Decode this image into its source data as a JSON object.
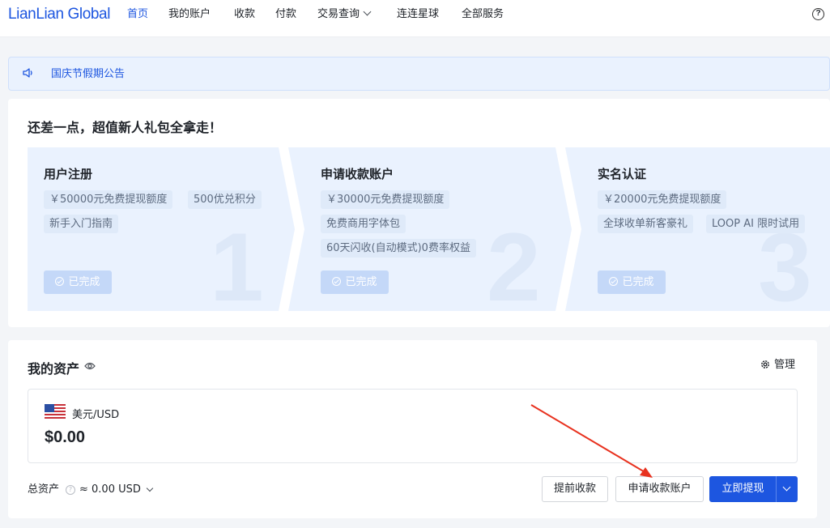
{
  "brand": "LianLian Global",
  "nav": {
    "items": [
      "首页",
      "我的账户",
      "收款",
      "付款",
      "交易查询",
      "连连星球",
      "全部服务"
    ]
  },
  "notice": {
    "text": "国庆节假期公告"
  },
  "onboarding": {
    "title": "还差一点，超值新人礼包全拿走！",
    "steps": [
      {
        "number": "1",
        "title": "用户注册",
        "tags": [
          "￥50000元免费提现额度",
          "500优兑积分",
          "新手入门指南"
        ],
        "status": "已完成"
      },
      {
        "number": "2",
        "title": "申请收款账户",
        "tags": [
          "￥30000元免费提现额度",
          "免费商用字体包",
          "60天闪收(自动模式)0费率权益"
        ],
        "status": "已完成"
      },
      {
        "number": "3",
        "title": "实名认证",
        "tags": [
          "￥20000元免费提现额度",
          "全球收单新客豪礼",
          "LOOP AI 限时试用"
        ],
        "status": "已完成"
      }
    ]
  },
  "assets": {
    "title": "我的资产",
    "manage_label": "管理",
    "currency": {
      "label": "美元/USD",
      "amount": "$0.00"
    },
    "total_label": "总资产",
    "total_value": "≈ 0.00 USD",
    "buttons": {
      "advance": "提前收款",
      "apply": "申请收款账户",
      "withdraw": "立即提现"
    }
  },
  "colors": {
    "brand_blue": "#1d56e0",
    "step_bg": "#eaf2fe",
    "annotation_arrow": "#e8321f"
  }
}
